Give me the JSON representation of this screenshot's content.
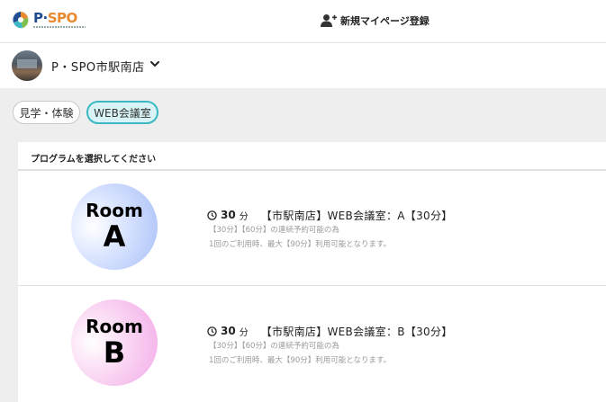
{
  "header": {
    "logo_text_main": "P·SPO",
    "register_label": "新規マイページ登録",
    "icons": {
      "register": "user-plus-icon",
      "logo": "pspo-logo-mark-icon"
    }
  },
  "store": {
    "name": "P・SPO市駅南店",
    "icons": {
      "chevron": "chevron-down-icon"
    }
  },
  "tabs": [
    {
      "label": "見学・体験",
      "selected": false
    },
    {
      "label": "WEB会議室",
      "selected": true
    }
  ],
  "colors": {
    "accent": "#3bb8c3",
    "tab_selected_bg": "#d9f4f6",
    "brand_blue": "#1f4d8f",
    "brand_orange": "#e9892e"
  },
  "panel": {
    "title": "プログラムを選択してください",
    "programs": [
      {
        "room_word": "Room",
        "room_letter": "A",
        "duration": "30",
        "duration_unit": "分",
        "name": "【市駅南店】WEB会議室：A【30分】",
        "note_1": "【30分】【60分】の連続予約可能の為",
        "note_2": "1回のご利用時、最大【90分】利用可能となります。",
        "icon": "clock-icon"
      },
      {
        "room_word": "Room",
        "room_letter": "B",
        "duration": "30",
        "duration_unit": "分",
        "name": "【市駅南店】WEB会議室：B【30分】",
        "note_1": "【30分】【60分】の連続予約可能の為",
        "note_2": "1回のご利用時、最大【90分】利用可能となります。",
        "icon": "clock-icon"
      }
    ]
  }
}
